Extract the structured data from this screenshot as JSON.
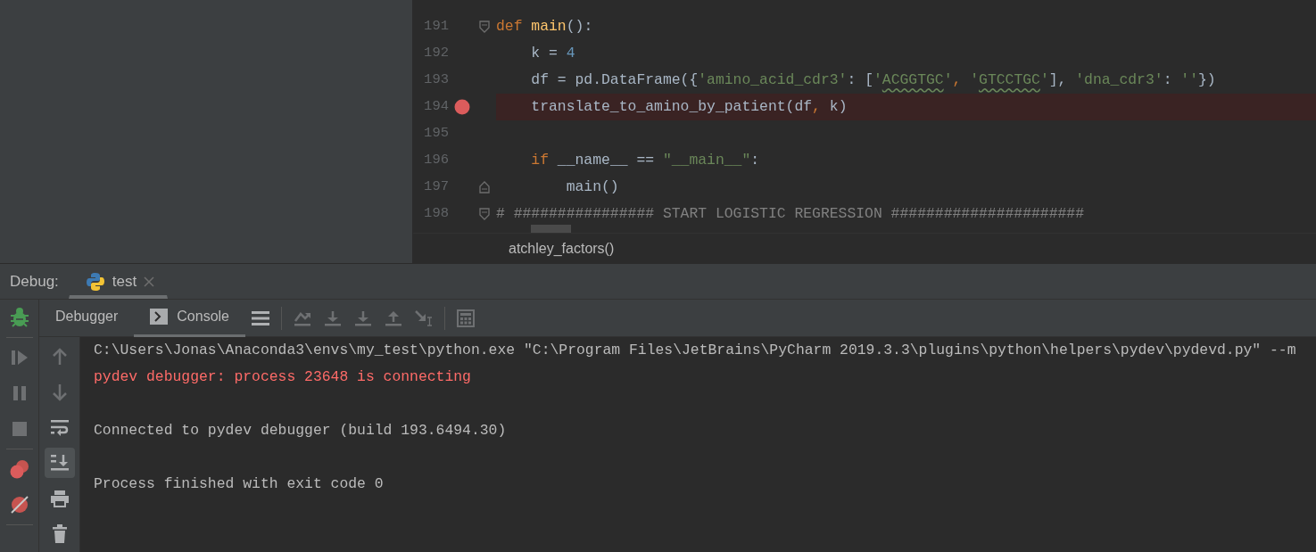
{
  "editor": {
    "lines": [
      {
        "number": "191",
        "breakpoint": false,
        "fold_start": true,
        "fold_end": false,
        "tokens": [
          {
            "kind": "keyword",
            "text": "def "
          },
          {
            "kind": "function",
            "text": "main"
          },
          {
            "kind": "plain",
            "text": "():"
          }
        ]
      },
      {
        "number": "192",
        "breakpoint": false,
        "fold_start": false,
        "fold_end": false,
        "tokens": [
          {
            "kind": "plain",
            "text": "    k = "
          },
          {
            "kind": "number",
            "text": "4"
          }
        ]
      },
      {
        "number": "193",
        "breakpoint": false,
        "fold_start": false,
        "fold_end": false,
        "tokens": [
          {
            "kind": "plain",
            "text": "    df = pd.DataFrame({"
          },
          {
            "kind": "string",
            "text": "'amino_acid_cdr3'"
          },
          {
            "kind": "plain",
            "text": ": ["
          },
          {
            "kind": "string",
            "text": "'"
          },
          {
            "kind": "string",
            "text": "ACGGTGC",
            "typo": true
          },
          {
            "kind": "string",
            "text": "'"
          },
          {
            "kind": "keyword",
            "text": ", "
          },
          {
            "kind": "string",
            "text": "'"
          },
          {
            "kind": "string",
            "text": "GTCCTGC",
            "typo": true
          },
          {
            "kind": "string",
            "text": "'"
          },
          {
            "kind": "plain",
            "text": "], "
          },
          {
            "kind": "string",
            "text": "'dna_cdr3'"
          },
          {
            "kind": "plain",
            "text": ": "
          },
          {
            "kind": "string",
            "text": "''"
          },
          {
            "kind": "plain",
            "text": "})"
          }
        ]
      },
      {
        "number": "194",
        "breakpoint": true,
        "fold_start": false,
        "fold_end": false,
        "tokens": [
          {
            "kind": "plain",
            "text": "    translate_to_amino_by_patient(df"
          },
          {
            "kind": "keyword",
            "text": ", "
          },
          {
            "kind": "plain",
            "text": "k)"
          }
        ]
      },
      {
        "number": "195",
        "breakpoint": false,
        "fold_start": false,
        "fold_end": false
      },
      {
        "number": "196",
        "breakpoint": false,
        "fold_start": false,
        "fold_end": false,
        "tokens": [
          {
            "kind": "keyword",
            "text": "    if "
          },
          {
            "kind": "plain",
            "text": "__name__ == "
          },
          {
            "kind": "string",
            "text": "\"__main__\""
          },
          {
            "kind": "plain",
            "text": ":"
          }
        ]
      },
      {
        "number": "197",
        "breakpoint": false,
        "fold_start": false,
        "fold_end": true,
        "tokens": [
          {
            "kind": "plain",
            "text": "        main()"
          }
        ]
      },
      {
        "number": "198",
        "breakpoint": false,
        "fold_start": true,
        "fold_end": false,
        "tokens": [
          {
            "kind": "comment",
            "text": "# ################ START LOGISTIC REGRESSION ######################"
          }
        ]
      }
    ],
    "breadcrumb": "atchley_factors()"
  },
  "debug": {
    "label": "Debug:",
    "tabs": [
      {
        "label": "test",
        "selected": true
      }
    ],
    "view_tabs": [
      {
        "label": "Debugger",
        "icon": false,
        "selected": false
      },
      {
        "label": "Console",
        "icon": true,
        "selected": true
      }
    ],
    "toolbar": [
      {
        "kind": "menu",
        "disabled": false
      },
      {
        "kind": "sep"
      },
      {
        "kind": "step-over",
        "disabled": true
      },
      {
        "kind": "step-into",
        "disabled": true
      },
      {
        "kind": "step-into",
        "disabled": true
      },
      {
        "kind": "step-out",
        "disabled": true
      },
      {
        "kind": "run-to-cursor",
        "disabled": true
      },
      {
        "kind": "sep"
      },
      {
        "kind": "calculator",
        "disabled": true
      }
    ],
    "actions": [
      {
        "kind": "sep"
      },
      {
        "kind": "resume",
        "disabled": true
      },
      {
        "kind": "pause",
        "disabled": true
      },
      {
        "kind": "stop",
        "disabled": true
      },
      {
        "kind": "sep"
      },
      {
        "kind": "breakpoints"
      },
      {
        "kind": "mute"
      },
      {
        "kind": "sep"
      }
    ],
    "console_tools": [
      {
        "kind": "up",
        "disabled": true,
        "on": false
      },
      {
        "kind": "down",
        "disabled": true,
        "on": false
      },
      {
        "kind": "wrap",
        "disabled": false,
        "on": false
      },
      {
        "kind": "scroll-end",
        "disabled": false,
        "on": true
      },
      {
        "kind": "print",
        "disabled": false,
        "on": false
      },
      {
        "kind": "trash",
        "disabled": false,
        "on": false
      }
    ],
    "console": [
      {
        "kind": "stdout",
        "text": "C:\\Users\\Jonas\\Anaconda3\\envs\\my_test\\python.exe \"C:\\Program Files\\JetBrains\\PyCharm 2019.3.3\\plugins\\python\\helpers\\pydev\\pydevd.py\" --m"
      },
      {
        "kind": "stderr",
        "text": "pydev debugger: process 23648 is connecting"
      },
      {
        "kind": "blank"
      },
      {
        "kind": "stdout",
        "text": "Connected to pydev debugger (build 193.6494.30)"
      },
      {
        "kind": "blank"
      },
      {
        "kind": "stdout",
        "text": "Process finished with exit code 0"
      }
    ]
  }
}
